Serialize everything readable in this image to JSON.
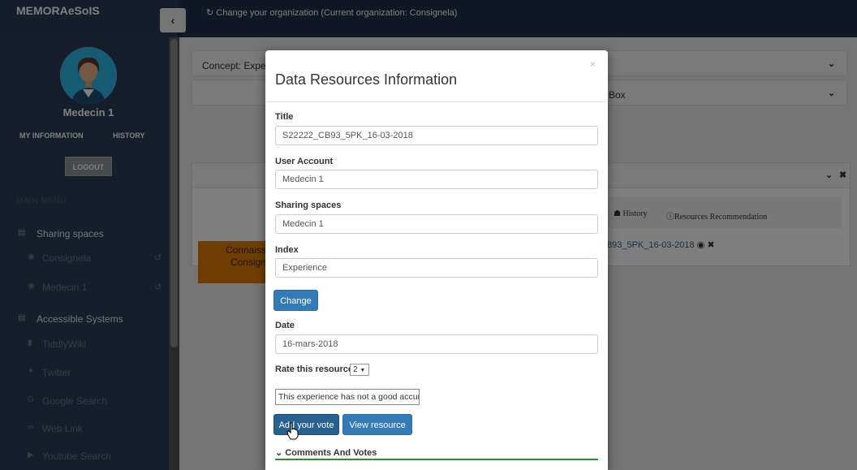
{
  "brand": "MEMORAeSoIS",
  "header": {
    "org_link": "Change your organization (Current organization: Consignela)"
  },
  "profile": {
    "name": "Medecin 1",
    "my_information": "MY INFORMATION",
    "history": "HISTORY",
    "logout": "LOGOUT"
  },
  "menu": {
    "title": "MAIN MENU",
    "sharing_spaces": "Sharing spaces",
    "consignela": "Consignela",
    "medecin1": "Medecin 1",
    "accessible_systems": "Accessible Systems",
    "tiddlywiki": "TiddlyWiki",
    "twitter": "Twitter",
    "google_search": "Google Search",
    "web_link": "Web Link",
    "youtube_search": "Youtube Search"
  },
  "background": {
    "concept_panel": "Concept: Expe",
    "search_box_panel": "h Box",
    "history_tab": "History",
    "resources_recommendation_tab": "Resources Recommendation",
    "resource_link": "893_5PK_16-03-2018",
    "orange_line1": "Connaiss",
    "orange_line2": "Consign"
  },
  "modal": {
    "title": "Data Resources Information",
    "close": "×",
    "title_label": "Title",
    "title_value": "S22222_CB93_5PK_16-03-2018",
    "user_account_label": "User Account",
    "user_account_value": "Medecin 1",
    "sharing_spaces_label": "Sharing spaces",
    "sharing_spaces_value": "Medecin 1",
    "index_label": "Index",
    "index_value": "Experience",
    "change_button": "Change",
    "date_label": "Date",
    "date_value": "16-mars-2018",
    "rate_label": "Rate this resource",
    "rate_value": "2",
    "comment_value": "This experience has not a good accura",
    "add_vote_button": "Add your vote",
    "view_resource_button": "View resource",
    "comments_votes": "Comments And Votes"
  }
}
